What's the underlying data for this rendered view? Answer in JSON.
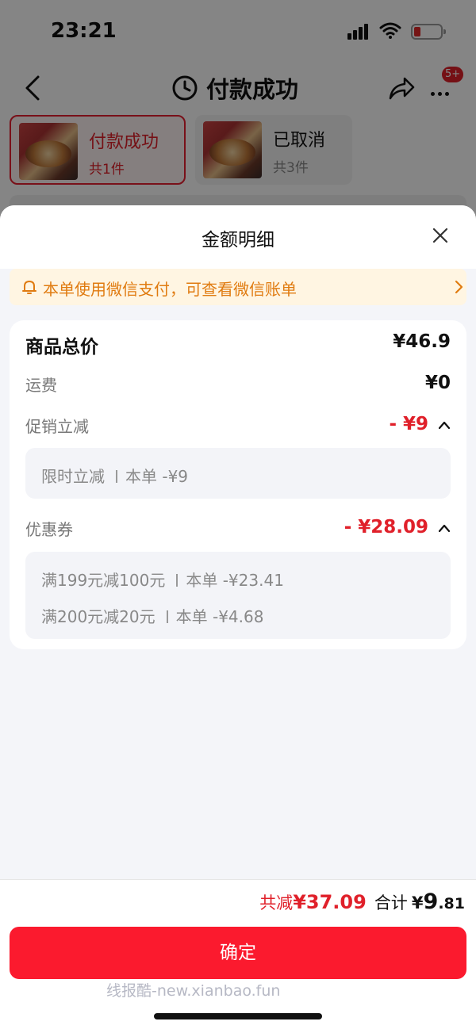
{
  "status_bar": {
    "time": "23:21"
  },
  "nav": {
    "title": "付款成功",
    "badge": "5+"
  },
  "orders": [
    {
      "status": "付款成功",
      "count": "共1件"
    },
    {
      "status": "已取消",
      "count": "共3件"
    }
  ],
  "sheet": {
    "title": "金额明细",
    "notice": "本单使用微信支付，可查看微信账单",
    "total": {
      "label": "商品总价",
      "value": "¥46.9"
    },
    "shipping": {
      "label": "运费",
      "value": "¥0"
    },
    "promo": {
      "label": "促销立减",
      "value": "- ¥9",
      "items": [
        {
          "name": "限时立减",
          "amount": "本单 -¥9"
        }
      ]
    },
    "coupon": {
      "label": "优惠券",
      "value": "- ¥28.09",
      "items": [
        {
          "name": "满199元减100元",
          "amount": "本单 -¥23.41"
        },
        {
          "name": "满200元减20元",
          "amount": "本单 -¥4.68"
        }
      ]
    }
  },
  "footer": {
    "saved_label": "共减",
    "saved_value": "¥37.09",
    "grand_label": "合计",
    "grand_symbol": "¥",
    "grand_int": "9",
    "grand_dec": ".81",
    "confirm": "确定",
    "watermark": "线报酷-new.xianbao.fun"
  },
  "colors": {
    "accent": "#fb1a2e",
    "notice_text": "#e07b10",
    "notice_bg": "#fff5e2"
  }
}
